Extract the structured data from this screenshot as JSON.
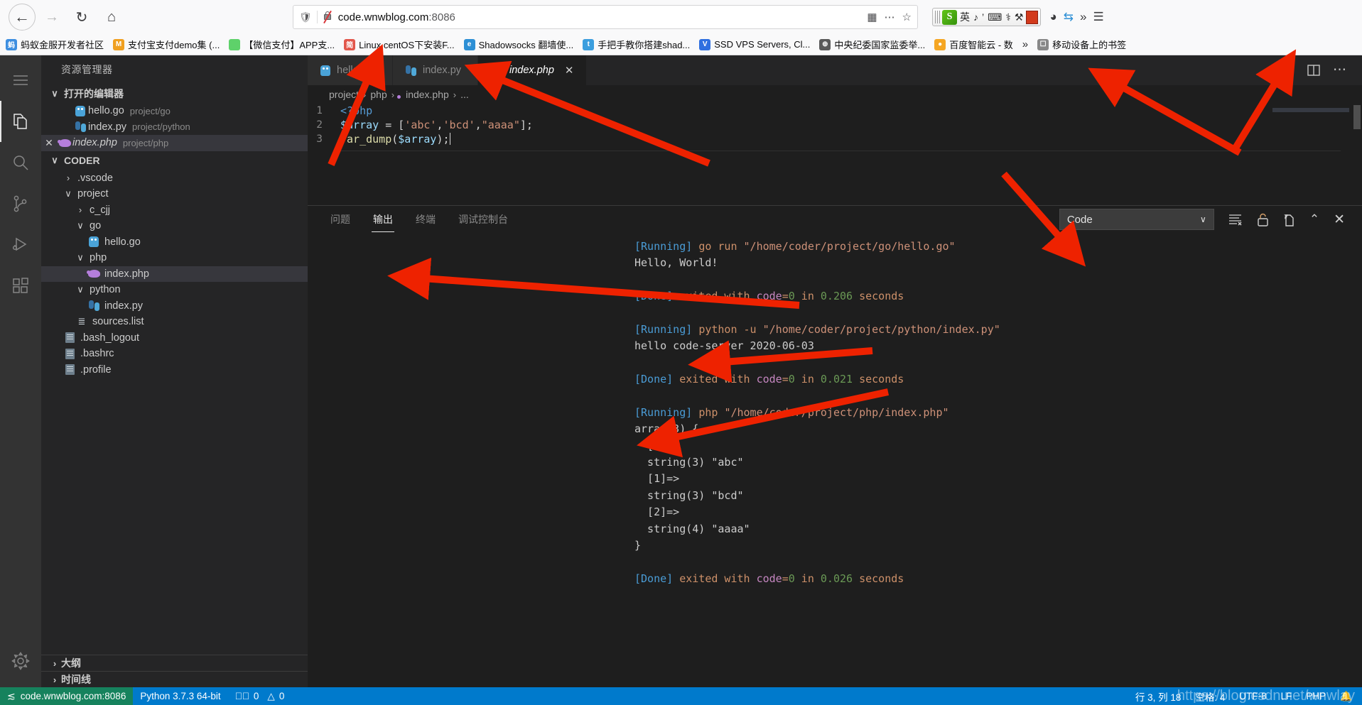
{
  "browser": {
    "back_icon": "arrow-left-icon",
    "forward_icon": "arrow-right-icon",
    "reload_icon": "reload-icon",
    "home_icon": "home-icon",
    "url": "code.wnwblog.com",
    "url_port": ":8086",
    "shield_icon": "shield-icon",
    "lock_icon": "lock-struck-icon",
    "qr_icon": "qr-code-icon",
    "more_icon": "ellipsis-icon",
    "bookmark_star_icon": "star-icon",
    "sync_icon": "sync-icon",
    "container_icon": "container-tabs-icon",
    "overflow_icon": "chevron-double-right-icon",
    "menu_icon": "hamburger-menu-icon",
    "ime": {
      "logo": "S",
      "items": [
        "英",
        "♪",
        "’",
        "⌨",
        "⚕",
        "⚒"
      ]
    },
    "bookmarks": [
      {
        "label": "蚂蚁金服开发者社区",
        "icon_text": "蚂",
        "color": "#3d8ee0"
      },
      {
        "label": "支付宝支付demo集 (...",
        "icon_text": "M",
        "color": "#f0a020"
      },
      {
        "label": "【微信支付】APP支...",
        "icon_text": "",
        "color": "#5ed16a"
      },
      {
        "label": "Linux centOS下安装F...",
        "icon_text": "简",
        "color": "#e2574c"
      },
      {
        "label": "Shadowsocks 翻墙使...",
        "icon_text": "e",
        "color": "#2d8fd5"
      },
      {
        "label": "手把手教你搭建shad...",
        "icon_text": "t",
        "color": "#3b9ede"
      },
      {
        "label": "SSD VPS Servers, Cl...",
        "icon_text": "V",
        "color": "#2f6fe0"
      },
      {
        "label": "中央纪委国家监委举...",
        "icon_text": "⊕",
        "color": "#5a5a5a"
      },
      {
        "label": "百度智能云 - 数",
        "icon_text": "●",
        "color": "#f5a623"
      }
    ],
    "bookmarks_overflow": "»",
    "mobile_bookmarks": "移动设备上的书签"
  },
  "activitybar": {
    "items": [
      {
        "name": "explorer",
        "icon": "files-icon",
        "active": true
      },
      {
        "name": "search",
        "icon": "search-icon",
        "active": false
      },
      {
        "name": "source-control",
        "icon": "source-control-icon",
        "active": false
      },
      {
        "name": "run-debug",
        "icon": "run-and-debug-icon",
        "active": false
      },
      {
        "name": "extensions",
        "icon": "extensions-icon",
        "active": false
      }
    ],
    "menu_icon": "hamburger-menu-icon",
    "settings_icon": "gear-icon"
  },
  "sidebar": {
    "title": "资源管理器",
    "open_editors": {
      "label": "打开的编辑器",
      "twisty": "∨",
      "items": [
        {
          "name": "hello.go",
          "desc": "project/go",
          "icon": "go-file-icon",
          "selected": false,
          "italic": false,
          "closable": false
        },
        {
          "name": "index.py",
          "desc": "project/python",
          "icon": "python-file-icon",
          "selected": false,
          "italic": false,
          "closable": false
        },
        {
          "name": "index.php",
          "desc": "project/php",
          "icon": "php-file-icon",
          "selected": true,
          "italic": true,
          "closable": true
        }
      ]
    },
    "workspace": {
      "label": "CODER",
      "twisty": "∨",
      "tree": [
        {
          "label": ".vscode",
          "indent": 1,
          "type": "folder",
          "expanded": false,
          "selected": false
        },
        {
          "label": "project",
          "indent": 1,
          "type": "folder",
          "expanded": true,
          "selected": false
        },
        {
          "label": "c_cjj",
          "indent": 2,
          "type": "folder",
          "expanded": false,
          "selected": false
        },
        {
          "label": "go",
          "indent": 2,
          "type": "folder",
          "expanded": true,
          "selected": false
        },
        {
          "label": "hello.go",
          "indent": 3,
          "type": "go-file",
          "selected": false
        },
        {
          "label": "php",
          "indent": 2,
          "type": "folder",
          "expanded": true,
          "selected": false
        },
        {
          "label": "index.php",
          "indent": 3,
          "type": "php-file",
          "selected": true
        },
        {
          "label": "python",
          "indent": 2,
          "type": "folder",
          "expanded": true,
          "selected": false
        },
        {
          "label": "index.py",
          "indent": 3,
          "type": "python-file",
          "selected": false
        },
        {
          "label": "sources.list",
          "indent": 2,
          "type": "list-file",
          "selected": false
        },
        {
          "label": ".bash_logout",
          "indent": 1,
          "type": "text-file",
          "selected": false
        },
        {
          "label": ".bashrc",
          "indent": 1,
          "type": "text-file",
          "selected": false
        },
        {
          "label": ".profile",
          "indent": 1,
          "type": "text-file",
          "selected": false
        }
      ]
    },
    "footer_sections": [
      {
        "label": "大纲",
        "twisty": "›"
      },
      {
        "label": "时间线",
        "twisty": "›"
      }
    ]
  },
  "editor": {
    "tabs": [
      {
        "label": "hello.go",
        "icon": "go-file-icon",
        "active": false,
        "italic": false,
        "closable": false
      },
      {
        "label": "index.py",
        "icon": "python-file-icon",
        "active": false,
        "italic": false,
        "closable": false
      },
      {
        "label": "index.php",
        "icon": "php-file-icon",
        "active": true,
        "italic": true,
        "closable": true,
        "close": "✕"
      }
    ],
    "actions": [
      {
        "name": "run-code-button",
        "icon": "play-icon"
      },
      {
        "name": "split-editor-button",
        "icon": "split-editor-icon"
      },
      {
        "name": "more-actions-button",
        "icon": "ellipsis-icon"
      }
    ],
    "breadcrumb": [
      "project",
      "php",
      "index.php",
      "..."
    ],
    "breadcrumb_sep": "›",
    "code_lines": [
      {
        "num": "1",
        "tokens": [
          {
            "t": "<?php",
            "c": "c-tag"
          }
        ]
      },
      {
        "num": "2",
        "tokens": [
          {
            "t": "$array",
            "c": "c-var"
          },
          {
            "t": " = ",
            "c": "c-op"
          },
          {
            "t": "[",
            "c": "c-pun"
          },
          {
            "t": "'abc'",
            "c": "c-str"
          },
          {
            "t": ",",
            "c": "c-pun"
          },
          {
            "t": "'bcd'",
            "c": "c-str"
          },
          {
            "t": ",",
            "c": "c-pun"
          },
          {
            "t": "\"aaaa\"",
            "c": "c-str"
          },
          {
            "t": "];",
            "c": "c-pun"
          }
        ]
      },
      {
        "num": "3",
        "tokens": [
          {
            "t": "var_dump",
            "c": "c-fn"
          },
          {
            "t": "(",
            "c": "c-pun"
          },
          {
            "t": "$array",
            "c": "c-var"
          },
          {
            "t": ");",
            "c": "c-pun"
          }
        ]
      }
    ]
  },
  "panel": {
    "tabs": [
      {
        "label": "问题",
        "active": false
      },
      {
        "label": "输出",
        "active": true
      },
      {
        "label": "终端",
        "active": false
      },
      {
        "label": "调试控制台",
        "active": false
      }
    ],
    "select_value": "Code",
    "select_chevron": "∨",
    "actions": [
      {
        "name": "clear-output-button",
        "icon": "clear-output-icon"
      },
      {
        "name": "lock-scroll-button",
        "icon": "unlock-icon"
      },
      {
        "name": "open-in-editor-button",
        "icon": "open-file-icon"
      },
      {
        "name": "collapse-panel-button",
        "icon": "chevron-up-icon"
      },
      {
        "name": "close-panel-button",
        "icon": "close-icon"
      }
    ],
    "output_lines": [
      [
        {
          "t": "[Running] ",
          "c": "o-run"
        },
        {
          "t": "go run ",
          "c": "o-cmd"
        },
        {
          "t": "\"/home/coder/project/go/hello.go\"",
          "c": "o-path"
        }
      ],
      [
        {
          "t": "Hello, World!",
          "c": "o-plain"
        }
      ],
      [
        {
          "t": "",
          "c": "o-plain"
        }
      ],
      [
        {
          "t": "[Done] ",
          "c": "o-run"
        },
        {
          "t": "exited with ",
          "c": "o-word"
        },
        {
          "t": "code",
          "c": "o-code"
        },
        {
          "t": "=",
          "c": "o-word"
        },
        {
          "t": "0",
          "c": "o-num"
        },
        {
          "t": " in ",
          "c": "o-word"
        },
        {
          "t": "0.206",
          "c": "o-num"
        },
        {
          "t": " seconds",
          "c": "o-word"
        }
      ],
      [
        {
          "t": "",
          "c": "o-plain"
        }
      ],
      [
        {
          "t": "[Running] ",
          "c": "o-run"
        },
        {
          "t": "python -u ",
          "c": "o-cmd"
        },
        {
          "t": "\"/home/coder/project/python/index.py\"",
          "c": "o-path"
        }
      ],
      [
        {
          "t": "hello code-server 2020-06-03",
          "c": "o-plain"
        }
      ],
      [
        {
          "t": "",
          "c": "o-plain"
        }
      ],
      [
        {
          "t": "[Done] ",
          "c": "o-run"
        },
        {
          "t": "exited with ",
          "c": "o-word"
        },
        {
          "t": "code",
          "c": "o-code"
        },
        {
          "t": "=",
          "c": "o-word"
        },
        {
          "t": "0",
          "c": "o-num"
        },
        {
          "t": " in ",
          "c": "o-word"
        },
        {
          "t": "0.021",
          "c": "o-num"
        },
        {
          "t": " seconds",
          "c": "o-word"
        }
      ],
      [
        {
          "t": "",
          "c": "o-plain"
        }
      ],
      [
        {
          "t": "[Running] ",
          "c": "o-run"
        },
        {
          "t": "php ",
          "c": "o-cmd"
        },
        {
          "t": "\"/home/coder/project/php/index.php\"",
          "c": "o-path"
        }
      ],
      [
        {
          "t": "array(3) {",
          "c": "o-plain"
        }
      ],
      [
        {
          "t": "  [0]=>",
          "c": "o-plain"
        }
      ],
      [
        {
          "t": "  string(3) \"abc\"",
          "c": "o-plain"
        }
      ],
      [
        {
          "t": "  [1]=>",
          "c": "o-plain"
        }
      ],
      [
        {
          "t": "  string(3) \"bcd\"",
          "c": "o-plain"
        }
      ],
      [
        {
          "t": "  [2]=>",
          "c": "o-plain"
        }
      ],
      [
        {
          "t": "  string(4) \"aaaa\"",
          "c": "o-plain"
        }
      ],
      [
        {
          "t": "}",
          "c": "o-plain"
        }
      ],
      [
        {
          "t": "",
          "c": "o-plain"
        }
      ],
      [
        {
          "t": "[Done] ",
          "c": "o-run"
        },
        {
          "t": "exited with ",
          "c": "o-word"
        },
        {
          "t": "code",
          "c": "o-code"
        },
        {
          "t": "=",
          "c": "o-word"
        },
        {
          "t": "0",
          "c": "o-num"
        },
        {
          "t": " in ",
          "c": "o-word"
        },
        {
          "t": "0.026",
          "c": "o-num"
        },
        {
          "t": " seconds",
          "c": "o-word"
        }
      ]
    ]
  },
  "statusbar": {
    "remote": "code.wnwblog.com:8086",
    "remote_icon": "remote-host-icon",
    "python_version": "Python 3.7.3 64-bit",
    "errors_icon": "error-circle-icon",
    "errors": "0",
    "warnings_icon": "warning-triangle-icon",
    "warnings": "0",
    "cursor_position": "行 3, 列 18",
    "indentation": "空格: 4",
    "encoding": "UTF-8",
    "eol": "LF",
    "language": "PHP",
    "bell_icon": "bell-icon",
    "watermark": "https://blog.csdn.net/wnwlay"
  },
  "colors": {
    "accent": "#007acc",
    "remote_green": "#16825d",
    "arrow_red": "#ee2200",
    "editor_bg": "#1e1e1e",
    "sidebar_bg": "#252526",
    "activitybar_bg": "#333333"
  }
}
